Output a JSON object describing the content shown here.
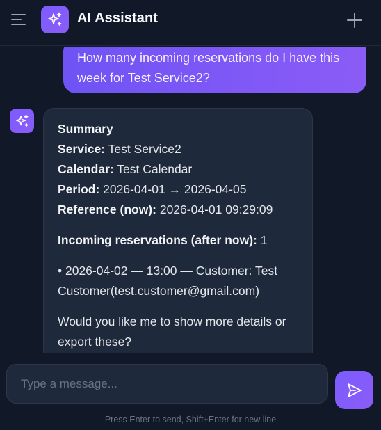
{
  "header": {
    "title": "AI Assistant",
    "menu_icon": "menu-icon",
    "logo_icon": "sparkles-icon",
    "new_chat_icon": "plus-icon"
  },
  "conversation": {
    "user_message": "How many incoming reservations do I have this week for Test Service2?",
    "assistant": {
      "heading": "Summary",
      "service_label": "Service:",
      "service_value": "Test Service2",
      "calendar_label": "Calendar:",
      "calendar_value": "Test Calendar",
      "period_label": "Period:",
      "period_value": "2026-04-01 → 2026-04-05",
      "reference_label": "Reference (now):",
      "reference_value": "2026-04-01 09:29:09",
      "incoming_label": "Incoming reservations (after now):",
      "incoming_value": "1",
      "reservation_item": "• 2026-04-02 — 13:00 — Customer: Test Customer(test.customer@gmail.com)",
      "followup": "Would you like me to show more details or export these?"
    }
  },
  "composer": {
    "placeholder": "Type a message...",
    "send_icon": "send-icon",
    "hint": "Press Enter to send, Shift+Enter for new line"
  },
  "colors": {
    "background": "#111827",
    "accent": "#7c5cff",
    "bubble_assistant": "#1e293b"
  }
}
